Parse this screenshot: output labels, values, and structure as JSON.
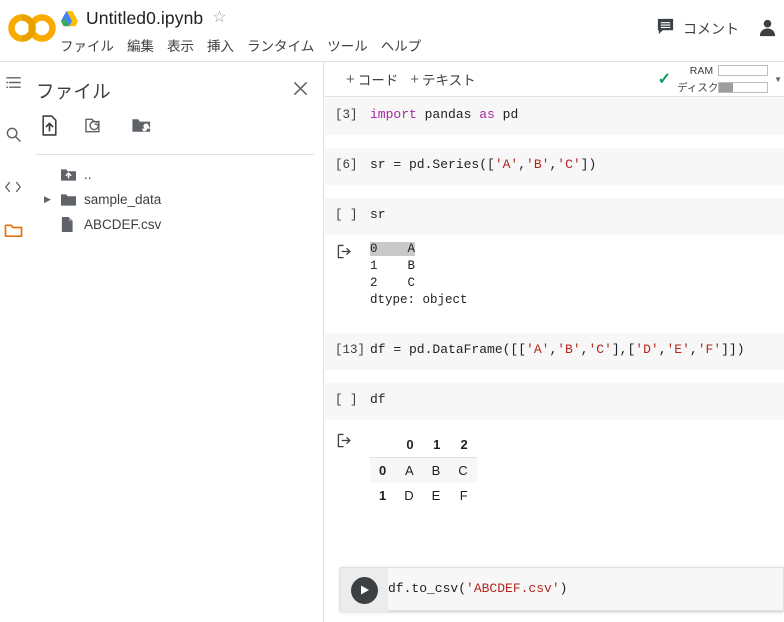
{
  "header": {
    "logo_icon": "colab-logo-icon",
    "drive_icon": "google-drive-icon",
    "title": "Untitled0.ipynb",
    "star_icon": "★",
    "star_glyph": "☆",
    "menu_items": [
      {
        "label": "ファイル"
      },
      {
        "label": "編集"
      },
      {
        "label": "表示"
      },
      {
        "label": "挿入"
      },
      {
        "label": "ランタイム"
      },
      {
        "label": "ツール"
      },
      {
        "label": "ヘルプ"
      }
    ],
    "comment_label": "コメント",
    "comment_icon": "comment-icon",
    "avatar_icon": "account-avatar-icon"
  },
  "rail": {
    "items": [
      {
        "name": "table-of-contents-icon",
        "label": "目次"
      },
      {
        "name": "search-icon",
        "label": "検索"
      },
      {
        "name": "code-snippets-icon",
        "label": "コード スニペット"
      },
      {
        "name": "files-folder-icon",
        "label": "ファイル",
        "active": true
      }
    ],
    "active_color": "#e8710a"
  },
  "files_panel": {
    "title": "ファイル",
    "close_icon": "close-icon",
    "tools": [
      {
        "name": "upload-file-icon",
        "label": "セッション ストレージにアップロード"
      },
      {
        "name": "refresh-folder-icon",
        "label": "更新"
      },
      {
        "name": "mount-drive-icon",
        "label": "ドライブをマウント"
      }
    ],
    "tree": [
      {
        "name": "parent-directory",
        "label": "..",
        "icon": "folder-up-icon",
        "caret": false
      },
      {
        "name": "sample-data-folder",
        "label": "sample_data",
        "icon": "folder-icon",
        "caret": true
      },
      {
        "name": "abcdef-csv-file",
        "label": "ABCDEF.csv",
        "icon": "file-icon",
        "caret": false
      }
    ]
  },
  "notebook": {
    "add_code_label": "コード",
    "add_text_label": "テキスト",
    "add_plus": "+",
    "status": {
      "check_icon": "connected-check-icon",
      "check_glyph": "✓",
      "ram_label": "RAM",
      "disk_label": "ディスク",
      "ram_fill_percent": 0,
      "disk_fill_percent": 30,
      "caret_glyph": "▼"
    },
    "cells": [
      {
        "id": "cell-import",
        "prompt": "[3]",
        "code_parts": [
          {
            "text": "import",
            "style": "kw"
          },
          {
            "text": " pandas ",
            "style": "plain"
          },
          {
            "text": "as",
            "style": "kw"
          },
          {
            "text": " pd",
            "style": "plain"
          }
        ],
        "code_plain": "import pandas as pd"
      },
      {
        "id": "cell-series",
        "prompt": "[6]",
        "code_parts": [
          {
            "text": "sr = pd.Series([",
            "style": "plain"
          },
          {
            "text": "'A'",
            "style": "str"
          },
          {
            "text": ",",
            "style": "plain"
          },
          {
            "text": "'B'",
            "style": "str"
          },
          {
            "text": ",",
            "style": "plain"
          },
          {
            "text": "'C'",
            "style": "str"
          },
          {
            "text": "])",
            "style": "plain"
          }
        ],
        "code_plain": "sr = pd.Series(['A','B','C'])"
      },
      {
        "id": "cell-show-series",
        "prompt": "[ ]",
        "code_parts": [
          {
            "text": "sr",
            "style": "plain"
          }
        ],
        "code_plain": "sr",
        "output": {
          "icon": "output-arrow-icon",
          "selected_line": "0    A",
          "lines": [
            "1    B",
            "2    C",
            "dtype: object"
          ]
        }
      },
      {
        "id": "cell-dataframe",
        "prompt": "[13]",
        "code_parts": [
          {
            "text": "df = pd.DataFrame([[",
            "style": "plain"
          },
          {
            "text": "'A'",
            "style": "str"
          },
          {
            "text": ",",
            "style": "plain"
          },
          {
            "text": "'B'",
            "style": "str"
          },
          {
            "text": ",",
            "style": "plain"
          },
          {
            "text": "'C'",
            "style": "str"
          },
          {
            "text": "],[",
            "style": "plain"
          },
          {
            "text": "'D'",
            "style": "str"
          },
          {
            "text": ",",
            "style": "plain"
          },
          {
            "text": "'E'",
            "style": "str"
          },
          {
            "text": ",",
            "style": "plain"
          },
          {
            "text": "'F'",
            "style": "str"
          },
          {
            "text": "]])",
            "style": "plain"
          }
        ],
        "code_plain": "df = pd.DataFrame([['A','B','C'],['D','E','F']])"
      },
      {
        "id": "cell-show-dataframe",
        "prompt": "[ ]",
        "code_parts": [
          {
            "text": "df",
            "style": "plain"
          }
        ],
        "code_plain": "df",
        "output": {
          "icon": "output-arrow-icon",
          "table": {
            "corner": "",
            "columns": [
              "0",
              "1",
              "2"
            ],
            "rows": [
              {
                "index": "0",
                "cells": [
                  "A",
                  "B",
                  "C"
                ]
              },
              {
                "index": "1",
                "cells": [
                  "D",
                  "E",
                  "F"
                ]
              }
            ]
          }
        }
      }
    ],
    "active_cell": {
      "id": "cell-to-csv",
      "run_icon": "run-play-icon",
      "code_parts": [
        {
          "text": "df.to_csv(",
          "style": "plain"
        },
        {
          "text": "'ABCDEF.csv'",
          "style": "str"
        },
        {
          "text": ")",
          "style": "plain"
        }
      ],
      "code_plain": "df.to_csv('ABCDEF.csv')"
    }
  },
  "colors": {
    "brand_orange": "#f9ab00",
    "cell_bg": "#f7f7f7",
    "keyword_purple": "#a626a4",
    "string_red": "#b3261e",
    "connected_green": "#0f9d58",
    "border_gray": "#e0e0e0"
  }
}
